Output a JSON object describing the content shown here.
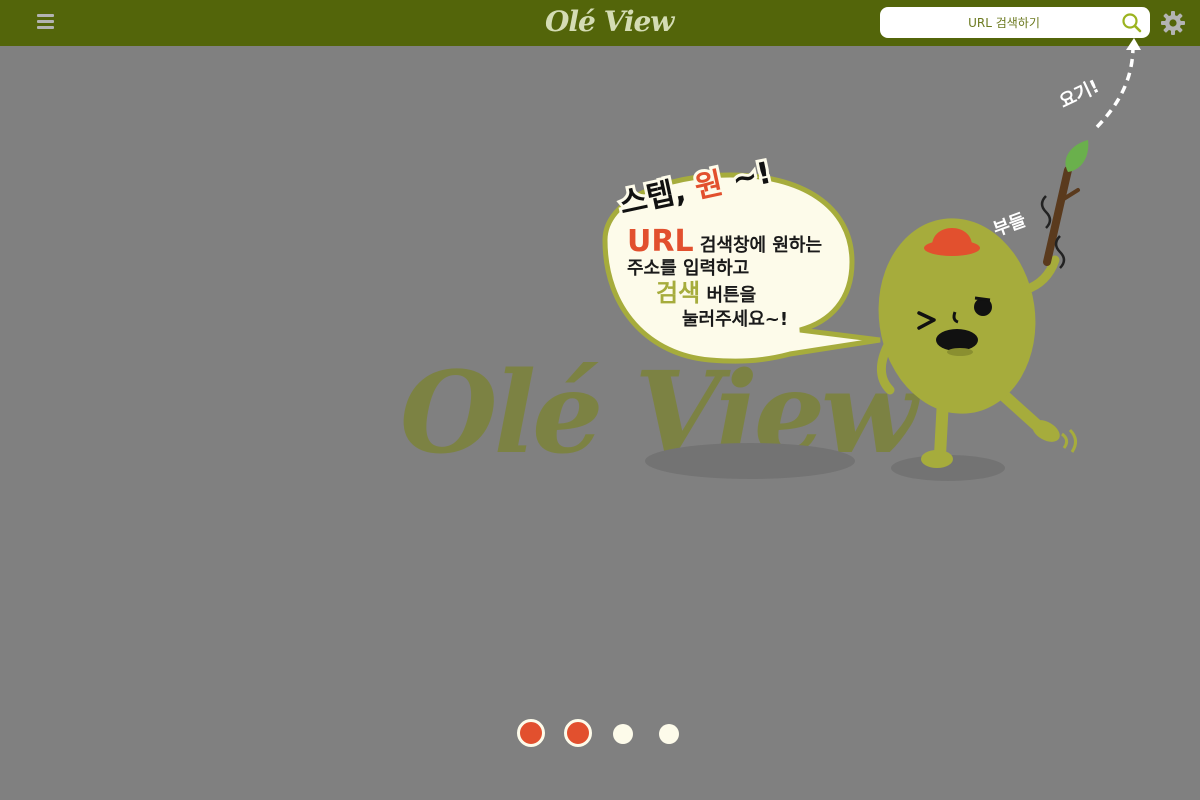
{
  "header": {
    "brand": "Olé View",
    "search": {
      "placeholder": "URL 검색하기",
      "value": ""
    }
  },
  "tutorial": {
    "watermark": "Olé View",
    "bubble": {
      "title_a": "스텝,",
      "title_b": "원",
      "title_c": "~!",
      "line1_strong": "URL",
      "line1_rest": "검색창에 원하는",
      "line2": "주소를 입력하고",
      "line3_strong": "검색",
      "line3_rest": "버튼을",
      "line4": "눌러주세요~!"
    },
    "pointer_note": "요기!",
    "shake_note": "부들"
  },
  "pagination": {
    "total": 4,
    "active": [
      1,
      2
    ]
  },
  "colors": {
    "header_bg": "#53650a",
    "background": "#808080",
    "accent_red": "#e2502e",
    "olive": "#a6ac3c",
    "bubble_fill": "#fdfbea"
  },
  "icons": {
    "menu": "menu-icon",
    "search": "search-icon",
    "settings": "gear-icon",
    "leaf": "leaf-icon"
  }
}
